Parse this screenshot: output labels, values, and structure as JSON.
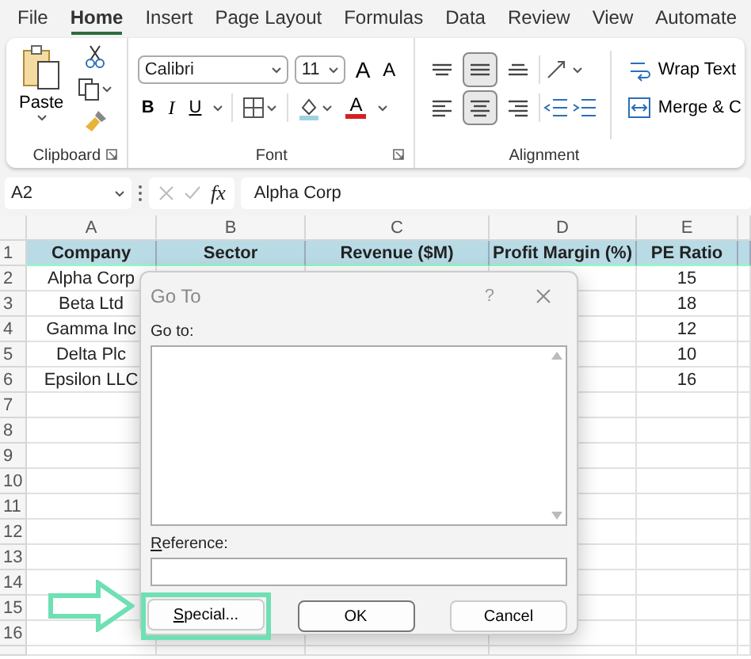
{
  "ribbon_tabs": [
    {
      "label": "File",
      "selected": false
    },
    {
      "label": "Home",
      "selected": true
    },
    {
      "label": "Insert",
      "selected": false
    },
    {
      "label": "Page Layout",
      "selected": false
    },
    {
      "label": "Formulas",
      "selected": false
    },
    {
      "label": "Data",
      "selected": false
    },
    {
      "label": "Review",
      "selected": false
    },
    {
      "label": "View",
      "selected": false
    },
    {
      "label": "Automate",
      "selected": false
    }
  ],
  "clipboard": {
    "paste_label": "Paste",
    "group_label": "Clipboard"
  },
  "font": {
    "name": "Calibri",
    "size": "11",
    "grow_label": "A",
    "shrink_label": "A",
    "bold_label": "B",
    "italic_label": "I",
    "underline_label": "U",
    "color_label": "A",
    "group_label": "Font"
  },
  "alignment": {
    "vertical": [
      {
        "kind": "top",
        "selected": false
      },
      {
        "kind": "middle",
        "selected": true
      },
      {
        "kind": "bottom",
        "selected": false
      }
    ],
    "horizontal": [
      {
        "kind": "left",
        "selected": false
      },
      {
        "kind": "center",
        "selected": true
      },
      {
        "kind": "right",
        "selected": false
      }
    ],
    "wrap_text": "Wrap Text",
    "merge": "Merge & C",
    "group_label": "Alignment"
  },
  "formula_bar": {
    "name_box": "A2",
    "function_label": "fx",
    "value": "Alpha Corp"
  },
  "sheet": {
    "columns": [
      "A",
      "B",
      "C",
      "D",
      "E"
    ],
    "header_row": [
      "Company",
      "Sector",
      "Revenue ($M)",
      "Profit Margin (%)",
      "PE Ratio"
    ],
    "row_numbers": [
      "1",
      "2",
      "3",
      "4",
      "5",
      "6",
      "7",
      "8",
      "9",
      "10",
      "11",
      "12",
      "13",
      "14",
      "15",
      "16"
    ],
    "rows": [
      {
        "company": "Alpha Corp",
        "pe_ratio": "15"
      },
      {
        "company": "Beta Ltd",
        "pe_ratio": "18"
      },
      {
        "company": "Gamma Inc",
        "pe_ratio": "12"
      },
      {
        "company": "Delta Plc",
        "pe_ratio": "10"
      },
      {
        "company": "Epsilon LLC",
        "pe_ratio": "16"
      }
    ]
  },
  "dialog": {
    "title": "Go To",
    "help": "?",
    "goto_label": "Go to:",
    "reference_label": "Reference:",
    "buttons": [
      {
        "label": "Special...",
        "kind": "normal",
        "highlighted": true
      },
      {
        "label": "OK",
        "kind": "default",
        "highlighted": false
      },
      {
        "label": "Cancel",
        "kind": "normal",
        "highlighted": false
      }
    ]
  }
}
